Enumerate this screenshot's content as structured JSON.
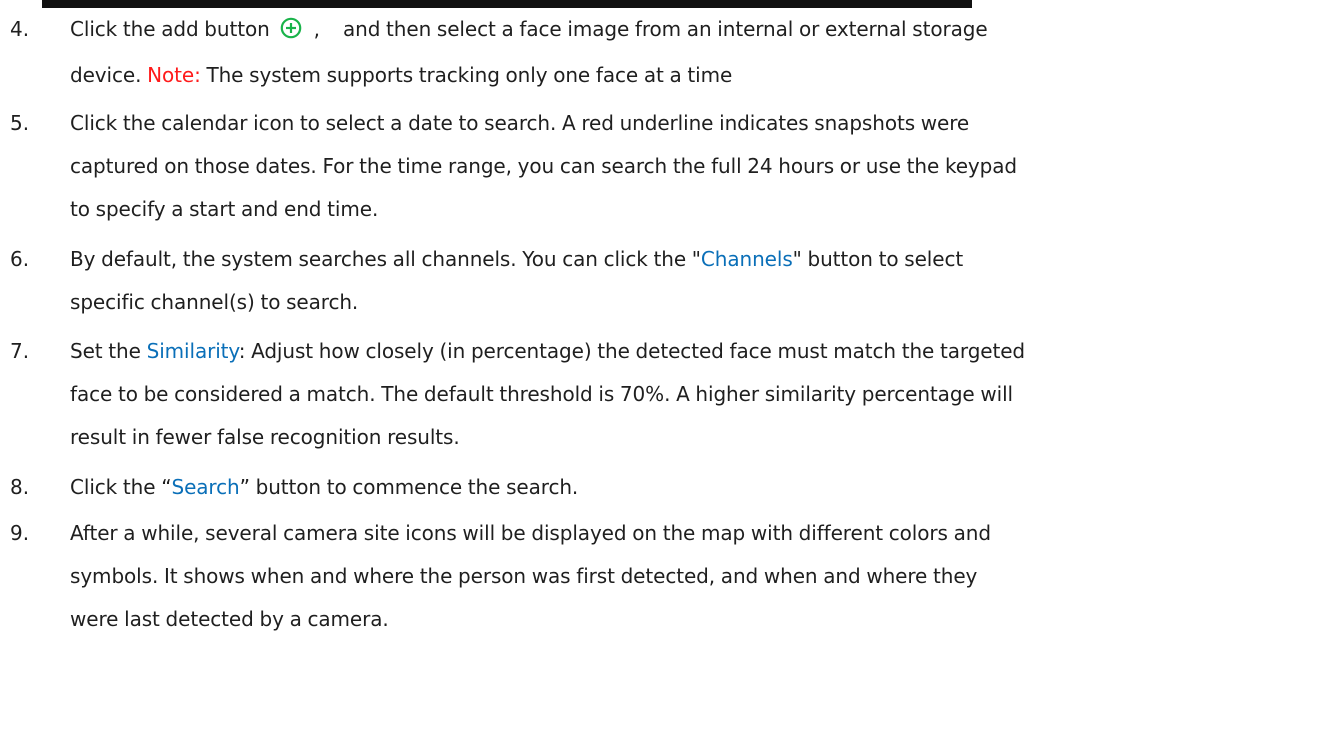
{
  "steps": [
    {
      "num": "4.",
      "a": "Click the add button",
      "b": ",",
      "c": "and then select a face image from an internal or external storage",
      "d": "device.",
      "note_label": "Note:",
      "note_text": "The system supports tracking only one face at a time",
      "icon": "add-circle-icon"
    },
    {
      "num": "5.",
      "l1": "Click the calendar icon to select a date to search. A red underline indicates snapshots were",
      "l2": "captured on those dates. For the time range, you can search the full 24 hours or use the keypad",
      "l3": "to specify a start and end time."
    },
    {
      "num": "6.",
      "a": "By default, the system searches all channels. You can click the \"",
      "link": "Channels",
      "b": "\" button to select",
      "l2": "specific channel(s) to search."
    },
    {
      "num": "7.",
      "a": "Set the ",
      "link": "Similarity",
      "b": ": Adjust how closely (in percentage) the detected face must match the targeted",
      "l2": "face to be considered a match. The default threshold is 70%. A higher similarity percentage will",
      "l3": "result in fewer false recognition results."
    },
    {
      "num": "8.",
      "a": "Click the “",
      "link": "Search",
      "b": "” button to commence the search."
    },
    {
      "num": "9.",
      "l1": "After a while, several camera site icons will be displayed on the map with different colors and",
      "l2": "symbols. It shows when and where the person was first detected, and when and where they",
      "l3": "were last detected by a camera."
    }
  ],
  "colors": {
    "note": "#ff1a1a",
    "link": "#0a6fb8",
    "icon": "#19b34a"
  }
}
